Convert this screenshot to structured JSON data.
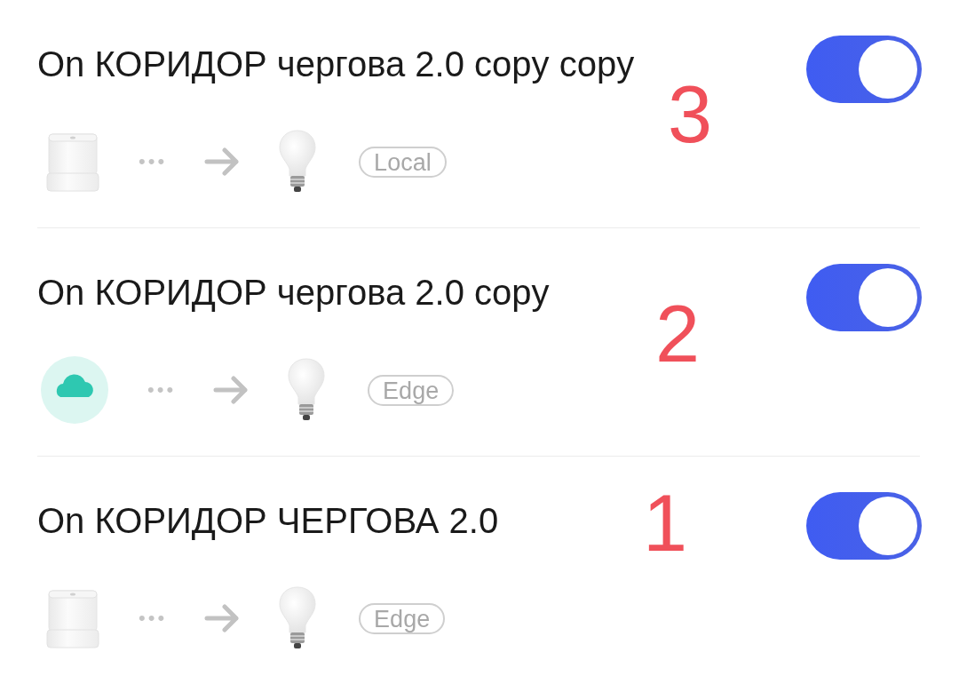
{
  "automations": [
    {
      "title": "On КОРИДОР чергова 2.0 copy copy",
      "annotation": "3",
      "trigger": {
        "kind": "sensor"
      },
      "dots": "•••",
      "action": {
        "kind": "bulb"
      },
      "mode": "Local",
      "on": true
    },
    {
      "title": "On КОРИДОР чергова 2.0 copy",
      "annotation": "2",
      "trigger": {
        "kind": "cloud"
      },
      "dots": "•••",
      "action": {
        "kind": "bulb"
      },
      "mode": "Edge",
      "on": true
    },
    {
      "title": "On КОРИДОР ЧЕРГОВА 2.0",
      "annotation": "1",
      "trigger": {
        "kind": "sensor"
      },
      "dots": "•••",
      "action": {
        "kind": "bulb"
      },
      "mode": "Edge",
      "on": true
    }
  ]
}
